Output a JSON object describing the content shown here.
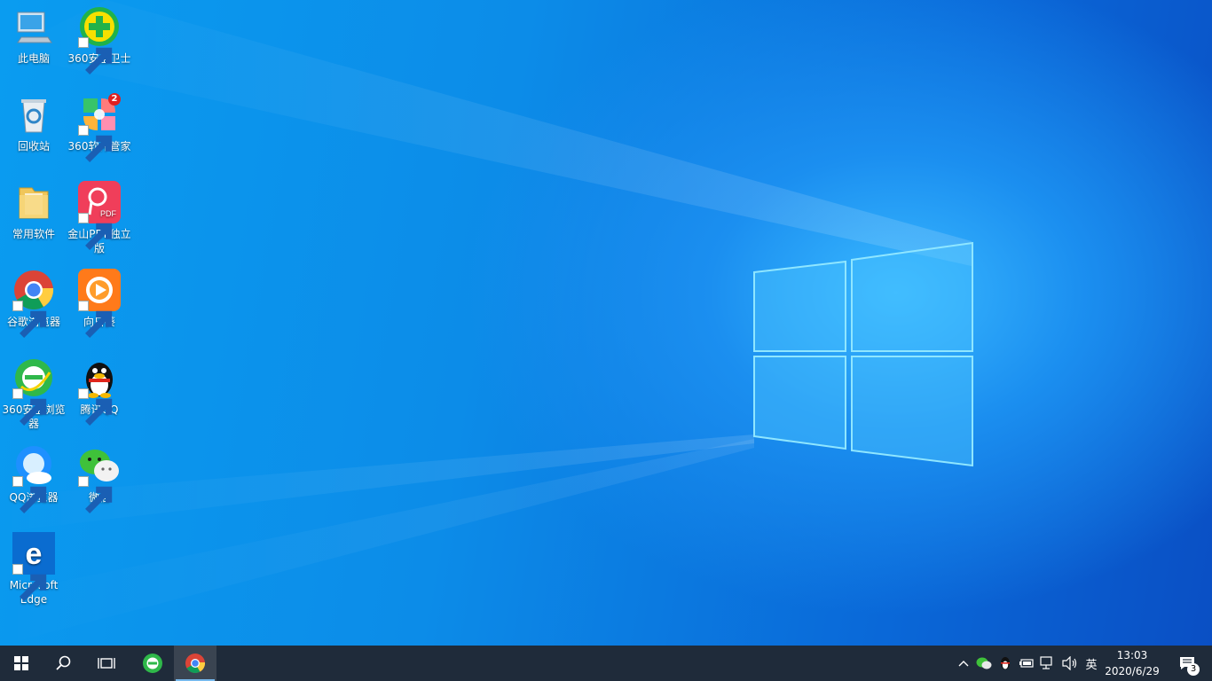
{
  "desktop": {
    "icons": [
      {
        "label": "此电脑"
      },
      {
        "label": "360安全卫士"
      },
      {
        "label": "回收站"
      },
      {
        "label": "360软件管家",
        "badge": "2"
      },
      {
        "label": "常用软件"
      },
      {
        "label": "金山PDF独立版"
      },
      {
        "label": "谷歌浏览器"
      },
      {
        "label": "向日葵"
      },
      {
        "label": "360安全浏览器"
      },
      {
        "label": "腾讯QQ"
      },
      {
        "label": "QQ浏览器"
      },
      {
        "label": "微信"
      },
      {
        "label": "Microsoft Edge"
      }
    ]
  },
  "taskbar": {
    "pinned": [
      "start-icon",
      "search-icon",
      "task-view-icon",
      "360-browser-icon",
      "chrome-icon"
    ],
    "tray": {
      "ime_label": "英",
      "time": "13:03",
      "date": "2020/6/29",
      "notification_count": "3"
    }
  },
  "colors": {
    "taskbar_bg": "#1f2b3a",
    "wallpaper_blue": "#0c8ce8",
    "accent": "#76b9ed"
  }
}
